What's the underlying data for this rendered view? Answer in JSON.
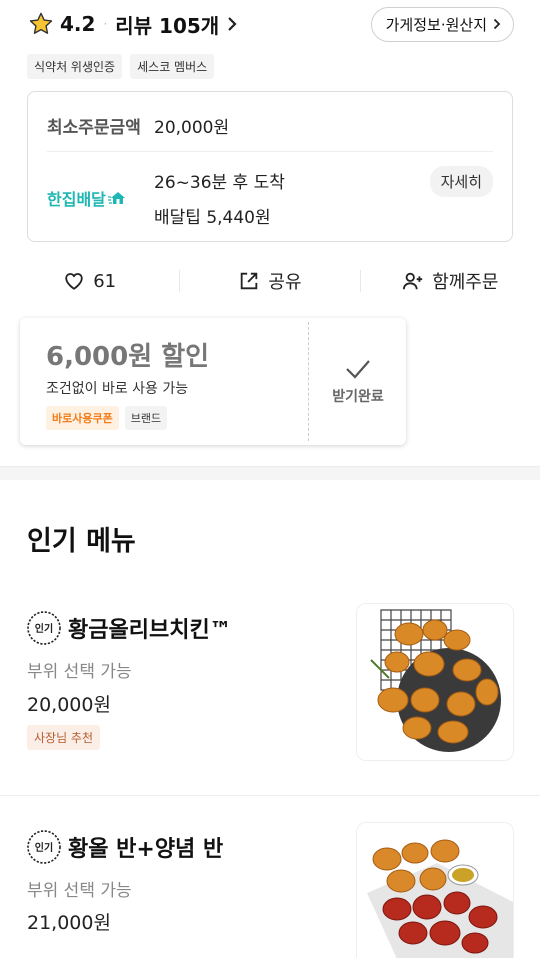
{
  "header": {
    "rating": "4.2",
    "separator": "·",
    "review_label": "리뷰 105개",
    "store_info_label": "가게정보·원산지"
  },
  "badges": [
    "식약처 위생인증",
    "세스코 멤버스"
  ],
  "order_info": {
    "min_order_label": "최소주문금액",
    "min_order_value": "20,000원",
    "delivery_brand": "한집배달",
    "arrival_time": "26~36분 후 도착",
    "delivery_tip": "배달팁 5,440원",
    "detail_label": "자세히"
  },
  "actions": {
    "like_count": "61",
    "share_label": "공유",
    "group_order_label": "함께주문"
  },
  "coupon": {
    "amount": "6,000원 할인",
    "description": "조건없이 바로 사용 가능",
    "tag_instant": "바로사용쿠폰",
    "tag_brand": "브랜드",
    "claimed_label": "받기완료"
  },
  "popular": {
    "title": "인기 메뉴",
    "badge_text": "인기",
    "items": [
      {
        "name": "황금올리브치킨™",
        "sub": "부위 선택 가능",
        "price": "20,000원",
        "badge": "사장님 추천"
      },
      {
        "name": "황올 반+양념 반",
        "sub": "부위 선택 가능",
        "price": "21,000원"
      }
    ]
  },
  "colors": {
    "accent_teal": "#1fb7b3",
    "coupon_orange": "#f07d1a",
    "star_yellow": "#f7c531"
  }
}
